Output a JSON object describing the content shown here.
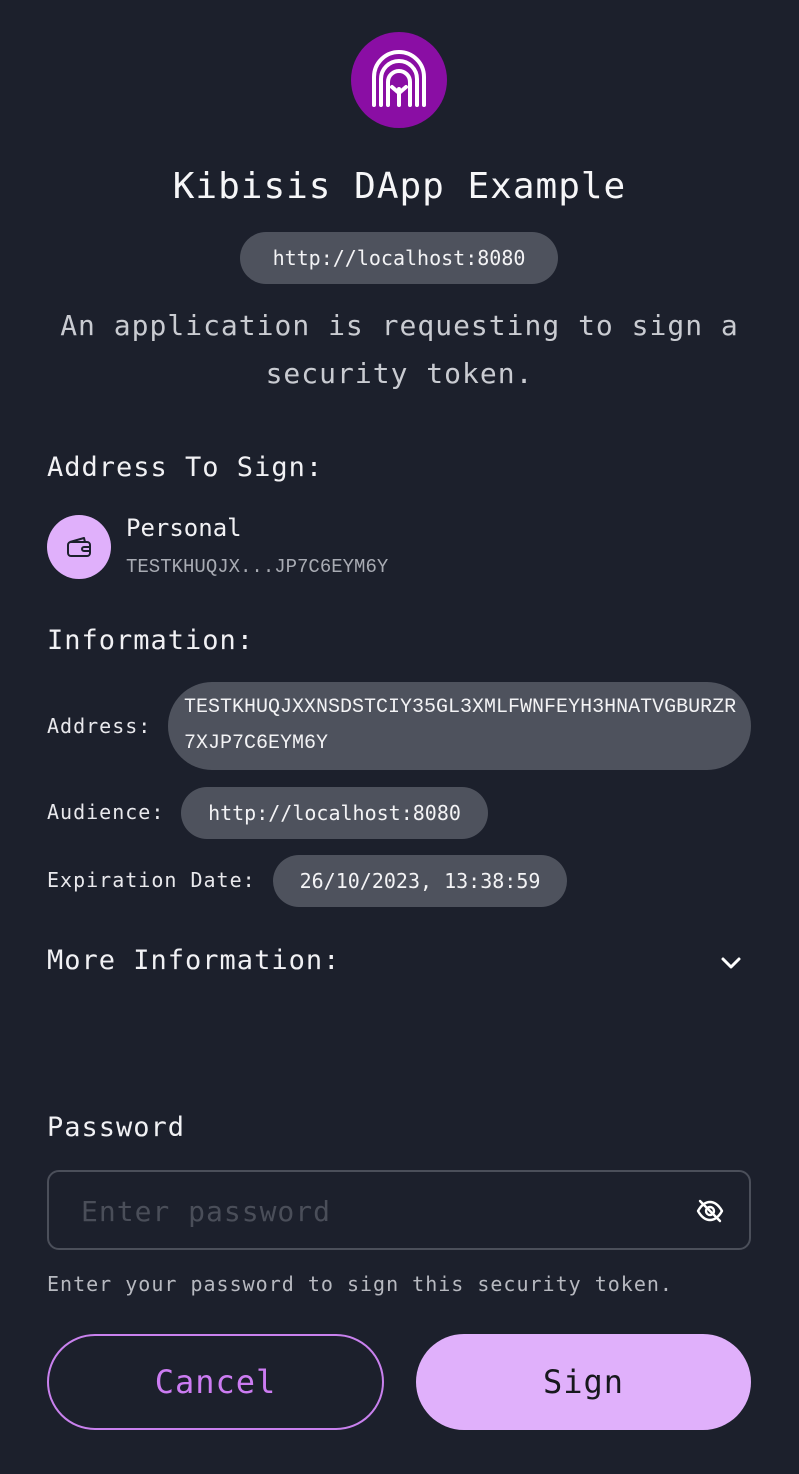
{
  "header": {
    "dapp_name": "Kibisis DApp Example",
    "origin": "http://localhost:8080",
    "description": "An application is requesting to sign a security token.",
    "logo_icon": "kibisis-arch-logo",
    "logo_color": "#8a0ea4"
  },
  "address_section": {
    "heading": "Address To Sign:",
    "account": {
      "name": "Personal",
      "address_short": "TESTKHUQJX...JP7C6EYM6Y",
      "icon": "wallet-icon"
    }
  },
  "information": {
    "heading": "Information:",
    "address_label": "Address:",
    "address_value": "TESTKHUQJXXNSDSTCIY35GL3XMLFWNFEYH3HNATVGBURZR7XJP7C6EYM6Y",
    "audience_label": "Audience:",
    "audience_value": "http://localhost:8080",
    "expiration_label": "Expiration Date:",
    "expiration_value": "26/10/2023, 13:38:59"
  },
  "more_information": {
    "heading": "More Information:",
    "expanded": false
  },
  "password": {
    "label": "Password",
    "placeholder": "Enter password",
    "value": "",
    "helper": "Enter your password to sign this security token.",
    "visibility_icon": "eye-slash-icon"
  },
  "actions": {
    "cancel_label": "Cancel",
    "sign_label": "Sign"
  },
  "colors": {
    "background": "#1c202c",
    "pill": "#4e525d",
    "accent": "#e0b0fb",
    "accent_text": "#cc7cf2"
  }
}
